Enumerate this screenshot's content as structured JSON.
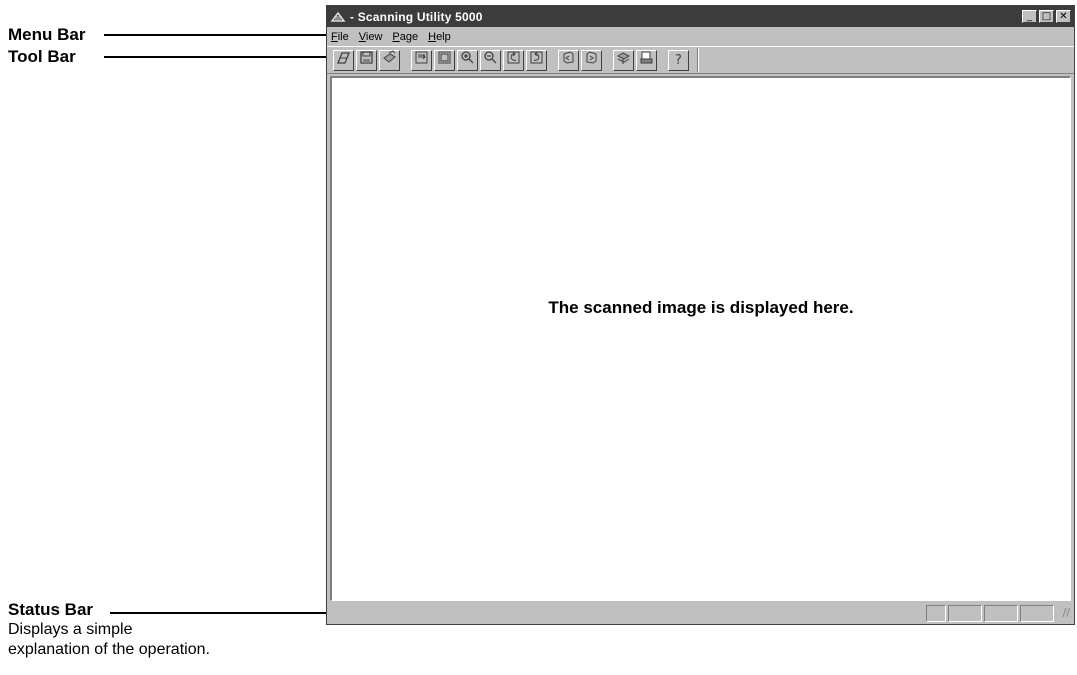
{
  "annotations": {
    "menu_bar": "Menu Bar",
    "tool_bar": "Tool Bar",
    "status_bar": "Status Bar",
    "status_bar_desc_line1": "Displays a simple",
    "status_bar_desc_line2": "explanation of the operation."
  },
  "window": {
    "title": "- Scanning Utility 5000",
    "app_icon": "scanner-icon",
    "controls": {
      "minimize": "_",
      "maximize": "□",
      "close": "✕"
    }
  },
  "menu": [
    {
      "label_u": "F",
      "label_rest": "ile"
    },
    {
      "label_u": "V",
      "label_rest": "iew"
    },
    {
      "label_u": "P",
      "label_rest": "age"
    },
    {
      "label_u": "H",
      "label_rest": "elp"
    }
  ],
  "toolbar": {
    "icons": [
      "scan-icon",
      "save-icon",
      "print-icon",
      "fit-width-icon",
      "fit-page-icon",
      "zoom-in-icon",
      "zoom-out-icon",
      "rotate-left-icon",
      "rotate-right-icon",
      "previous-page-icon",
      "next-page-icon",
      "acquire-icon",
      "send-icon",
      "help-icon"
    ],
    "help_glyph": "?"
  },
  "canvas": {
    "message": "The scanned image is displayed here."
  },
  "status_bar": {
    "text": "",
    "grip": "//"
  },
  "colors": {
    "titlebar": "#3c3c3c",
    "face": "#c0c0c0",
    "canvas": "#ffffff"
  }
}
